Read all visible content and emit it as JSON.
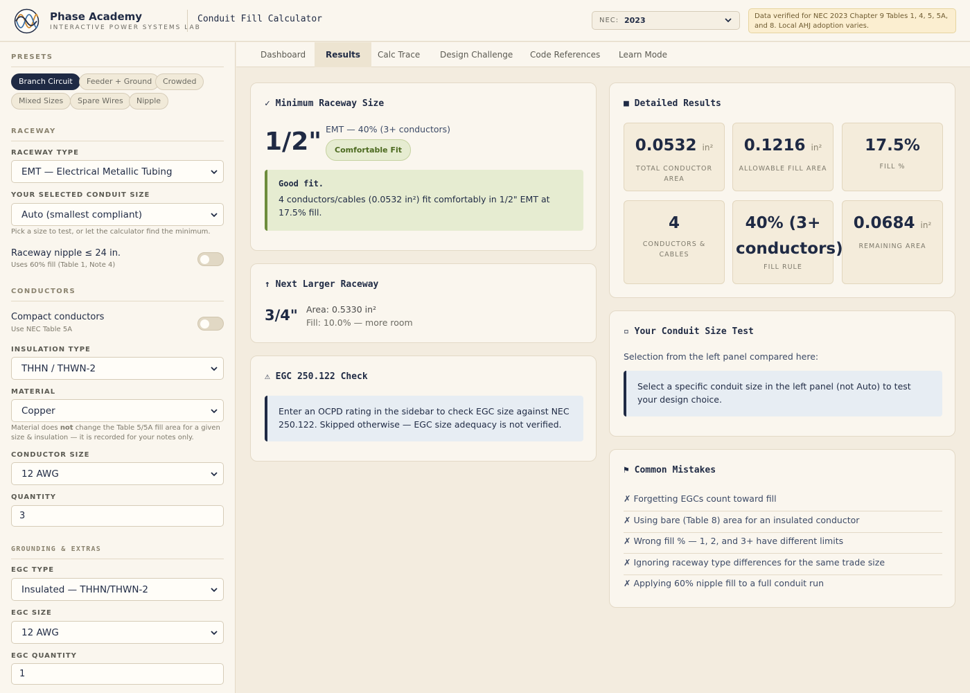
{
  "header": {
    "brand_name": "Phase Academy",
    "brand_sub": "INTERACTIVE POWER SYSTEMS LAB",
    "app_title": "Conduit Fill Calculator",
    "nec_label": "NEC:",
    "nec_value": "2023",
    "notice": "Data verified for NEC 2023 Chapter 9 Tables 1, 4, 5, 5A, and 8. Local AHJ adoption varies."
  },
  "sidebar": {
    "presets_title": "PRESETS",
    "presets": [
      "Branch Circuit",
      "Feeder + Ground",
      "Crowded",
      "Mixed Sizes",
      "Spare Wires",
      "Nipple"
    ],
    "raceway_title": "RACEWAY",
    "raceway_type_label": "RACEWAY TYPE",
    "raceway_type_value": "EMT — Electrical Metallic Tubing",
    "conduit_size_label": "YOUR SELECTED CONDUIT SIZE",
    "conduit_size_value": "Auto (smallest compliant)",
    "conduit_size_hint": "Pick a size to test, or let the calculator find the minimum.",
    "nipple_label": "Raceway nipple ≤ 24 in.",
    "nipple_hint": "Uses 60% fill (Table 1, Note 4)",
    "conductors_title": "CONDUCTORS",
    "compact_label": "Compact conductors",
    "compact_hint": "Use NEC Table 5A",
    "insulation_label": "INSULATION TYPE",
    "insulation_value": "THHN / THWN-2",
    "material_label": "MATERIAL",
    "material_value": "Copper",
    "material_hint_pre": "Material does ",
    "material_hint_bold": "not",
    "material_hint_post": " change the Table 5/5A fill area for a given size & insulation — it is recorded for your notes only.",
    "conductor_size_label": "CONDUCTOR SIZE",
    "conductor_size_value": "12 AWG",
    "quantity_label": "QUANTITY",
    "quantity_value": "3",
    "grounding_title": "GROUNDING & EXTRAS",
    "egc_type_label": "EGC TYPE",
    "egc_type_value": "Insulated — THHN/THWN-2",
    "egc_size_label": "EGC SIZE",
    "egc_size_value": "12 AWG",
    "egc_qty_label": "EGC QUANTITY",
    "egc_qty_value": "1"
  },
  "tabs": [
    "Dashboard",
    "Results",
    "Calc Trace",
    "Design Challenge",
    "Code References",
    "Learn Mode"
  ],
  "min_raceway": {
    "icon": "✓",
    "title": "Minimum Raceway Size",
    "size": "1/2\"",
    "desc": "EMT — 40% (3+ conductors)",
    "badge": "Comfortable Fit",
    "note_title": "Good fit.",
    "note_body": "4 conductors/cables (0.0532 in²) fit comfortably in 1/2\" EMT at 17.5% fill."
  },
  "next_raceway": {
    "icon": "↑",
    "title": "Next Larger Raceway",
    "size": "3/4\"",
    "area": "Area: 0.5330 in²",
    "fill": "Fill: 10.0% — more room"
  },
  "egc_check": {
    "icon": "⚠",
    "title": "EGC 250.122 Check",
    "body": "Enter an OCPD rating in the sidebar to check EGC size against NEC 250.122. Skipped otherwise — EGC size adequacy is not verified."
  },
  "detailed": {
    "icon": "■",
    "title": "Detailed Results",
    "stats": [
      {
        "value": "0.0532",
        "unit": "in²",
        "label": "TOTAL CONDUCTOR AREA"
      },
      {
        "value": "0.1216",
        "unit": "in²",
        "label": "ALLOWABLE FILL AREA"
      },
      {
        "value": "17.5%",
        "unit": "",
        "label": "FILL %"
      },
      {
        "value": "4",
        "unit": "",
        "label": "CONDUCTORS & CABLES"
      },
      {
        "value": "40% (3+ conductors)",
        "unit": "",
        "label": "FILL RULE"
      },
      {
        "value": "0.0684",
        "unit": "in²",
        "label": "REMAINING AREA"
      }
    ]
  },
  "size_test": {
    "icon": "▫",
    "title": "Your Conduit Size Test",
    "lead": "Selection from the left panel compared here:",
    "body": "Select a specific conduit size in the left panel (not Auto) to test your design choice."
  },
  "mistakes": {
    "icon": "⚑",
    "title": "Common Mistakes",
    "items": [
      "✗ Forgetting EGCs count toward fill",
      "✗ Using bare (Table 8) area for an insulated conductor",
      "✗ Wrong fill % — 1, 2, and 3+ have different limits",
      "✗ Ignoring raceway type differences for the same trade size",
      "✗ Applying 60% nipple fill to a full conduit run"
    ]
  }
}
